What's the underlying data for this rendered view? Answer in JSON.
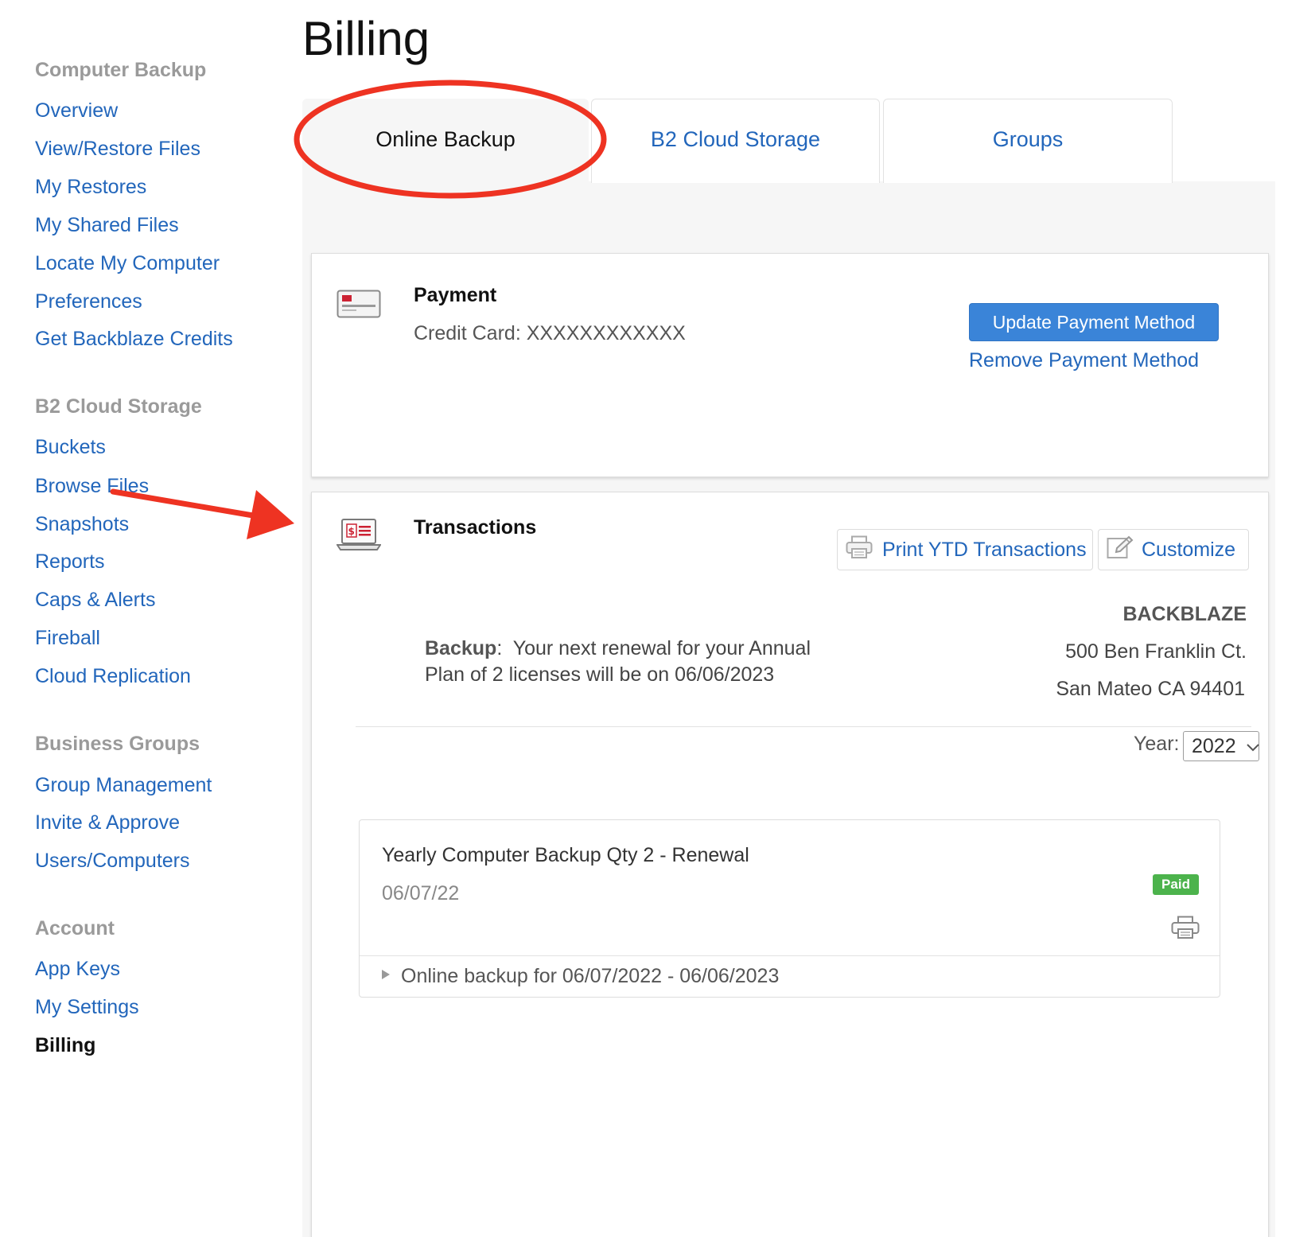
{
  "page": {
    "title": "Billing"
  },
  "sidebar": {
    "sections": [
      {
        "heading": "Computer Backup",
        "items": [
          "Overview",
          "View/Restore Files",
          "My Restores",
          "My Shared Files",
          "Locate My Computer",
          "Preferences",
          "Get Backblaze Credits"
        ]
      },
      {
        "heading": "B2 Cloud Storage",
        "items": [
          "Buckets",
          "Browse Files",
          "Snapshots",
          "Reports",
          "Caps & Alerts",
          "Fireball",
          "Cloud Replication"
        ]
      },
      {
        "heading": "Business Groups",
        "items": [
          "Group Management",
          "Invite & Approve",
          "Users/Computers"
        ]
      },
      {
        "heading": "Account",
        "items": [
          "App Keys",
          "My Settings",
          "Billing"
        ]
      }
    ],
    "active_item": "Billing"
  },
  "tabs": [
    {
      "label": "Online Backup",
      "active": true
    },
    {
      "label": "B2 Cloud Storage",
      "active": false
    },
    {
      "label": "Groups",
      "active": false
    }
  ],
  "payment": {
    "title": "Payment",
    "card_label": "Credit Card: XXXXXXXXXXXX",
    "update_button": "Update Payment Method",
    "remove_link": "Remove Payment Method"
  },
  "transactions": {
    "title": "Transactions",
    "print_button": "Print YTD Transactions",
    "customize_button": "Customize",
    "company": {
      "name": "BACKBLAZE",
      "address_line1": "500 Ben Franklin Ct.",
      "address_line2": "San Mateo CA 94401"
    },
    "renewal": {
      "label": "Backup",
      "line1": "Your next renewal for your Annual",
      "line2": "Plan of 2 licenses will be on 06/06/2023"
    },
    "year_label": "Year:",
    "year_value": "2022",
    "invoice": {
      "title": "Yearly Computer Backup Qty 2 - Renewal",
      "date": "06/07/22",
      "status": "Paid",
      "detail": "Online backup for 06/07/2022 - 06/06/2023"
    }
  },
  "colors": {
    "link": "#2266bb",
    "primary_button": "#3a84d8",
    "paid_badge": "#4cb34c",
    "annotation": "#ee3322"
  }
}
